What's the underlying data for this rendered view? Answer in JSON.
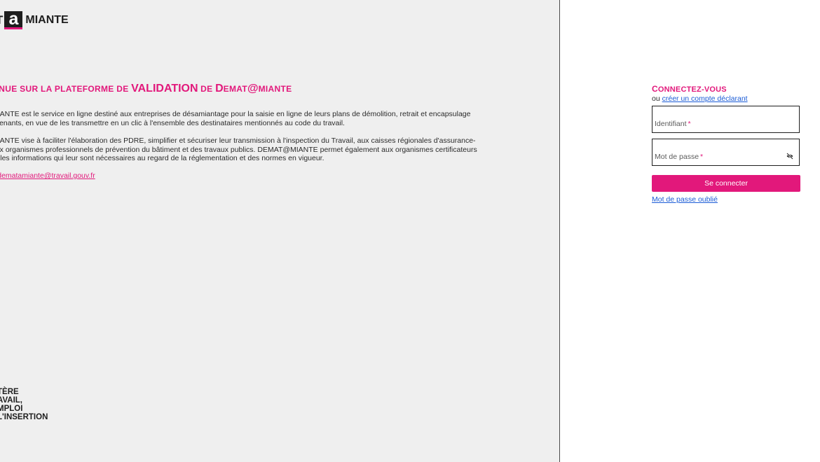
{
  "logo": {
    "prefix": "T",
    "letter": "a",
    "rest": "MIANTE"
  },
  "welcome": {
    "part1": "enue sur la plateforme de ",
    "part2": "VALIDATION",
    "part3": " de ",
    "part4_first": "D",
    "part4_rest": "emat",
    "part5": "@",
    "part6_first": "m",
    "part6_rest": "iante"
  },
  "paragraphs": {
    "p1_line1": "MIANTE est le service en ligne destiné aux entreprises de désamiantage pour la saisie en ligne de leurs plans de démolition, retrait et encapsulage",
    "p1_line2": "avenants, en vue de les transmettre en un clic à l'ensemble des destinataires mentionnés au code du travail.",
    "p2_line1": "MIANTE vise à faciliter l'élaboration des PDRE, simplifier et sécuriser leur transmission à l'inspection du Travail, aux caisses régionales d'assurance-",
    "p2_line2": "aux organismes professionnels de prévention du bâtiment et des travaux publics. DEMAT@MIANTE permet également aux organismes certificateurs",
    "p2_line3": "er les informations qui leur sont nécessaires au regard de la réglementation et des normes en vigueur."
  },
  "contact_email": "gt-dematamiante@travail.gouv.fr",
  "ministry": {
    "line1": "TÈRE",
    "line2": "AVAIL,",
    "line3": "MPLOI",
    "line4": "L'INSERTION"
  },
  "login": {
    "title_first": "C",
    "title_rest": "onnectez-vous",
    "sub_prefix": "ou ",
    "create_account_link": "créer un compte déclarant",
    "username_label": "Identifiant",
    "password_label": "Mot de passe",
    "required_mark": "*",
    "submit_label": "Se connecter",
    "forgot_link": "Mot de passe oublié"
  },
  "colors": {
    "accent": "#e2187b",
    "link": "#1a5bd6",
    "left_bg": "#efefef"
  },
  "icons": {
    "password_toggle": "eye-off-icon"
  }
}
